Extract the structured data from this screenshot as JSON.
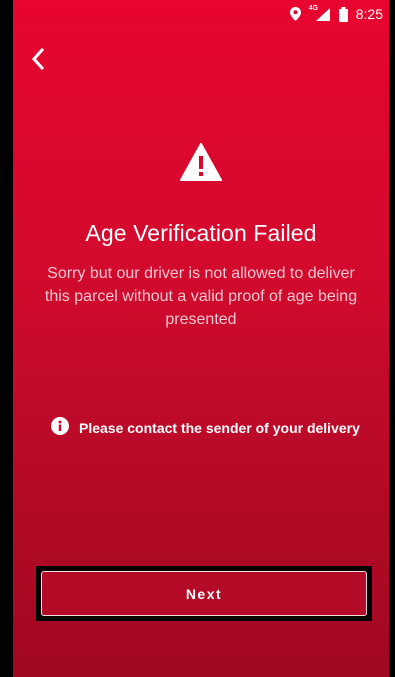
{
  "status_bar": {
    "location_icon": "location-pin-icon",
    "network": "4G",
    "network_icon": "signal-icon",
    "battery_icon": "battery-icon",
    "time": "8:25"
  },
  "navigation": {
    "back_icon": "chevron-left-icon"
  },
  "main": {
    "icon": "warning-icon",
    "title": "Age Verification Failed",
    "message": "Sorry but our driver is not allowed to deliver this parcel without a valid proof of age being presented",
    "info_icon": "info-icon",
    "info_text": "Please contact the sender of your delivery"
  },
  "actions": {
    "next_label": "Next"
  },
  "colors": {
    "background_top": "#e8052f",
    "background_bottom": "#a10822",
    "text": "#ffffff"
  }
}
